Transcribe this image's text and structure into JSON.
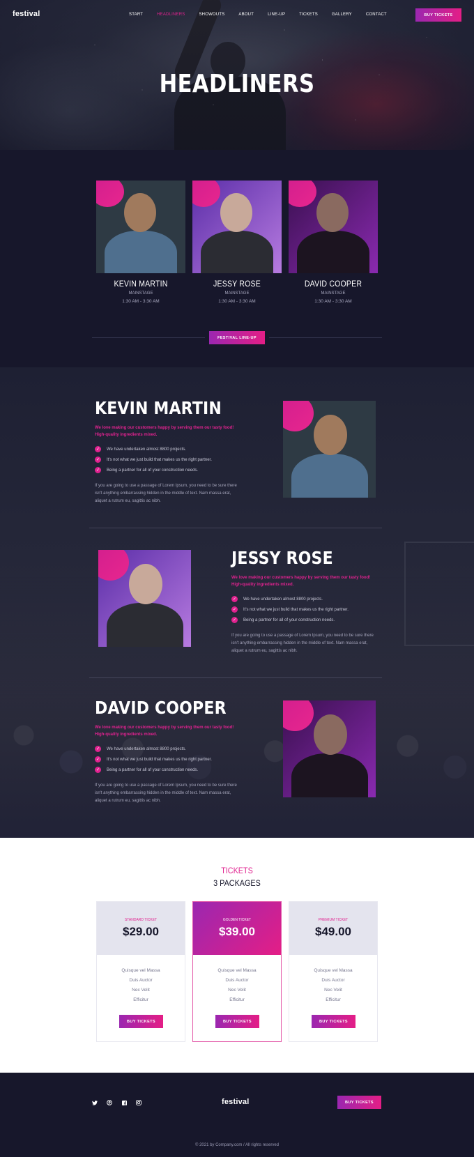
{
  "nav": {
    "logo": "festival",
    "items": [
      {
        "label": "START",
        "active": false
      },
      {
        "label": "HEADLINERS",
        "active": true
      },
      {
        "label": "SHOWOUTS",
        "active": false
      },
      {
        "label": "ABOUT",
        "active": false
      },
      {
        "label": "LINE-UP",
        "active": false
      },
      {
        "label": "TICKETS",
        "active": false
      },
      {
        "label": "GALLERY",
        "active": false
      },
      {
        "label": "CONTACT",
        "active": false
      }
    ],
    "cta": "BUY TICKETS"
  },
  "hero": {
    "title": "HEADLINERS"
  },
  "lineup": {
    "cards": [
      {
        "name": "KEVIN MARTIN",
        "stage": "MAINSTAGE",
        "time": "1:30 AM - 3:30 AM"
      },
      {
        "name": "JESSY ROSE",
        "stage": "MAINSTAGE",
        "time": "1:30 AM - 3:30 AM"
      },
      {
        "name": "DAVID COOPER",
        "stage": "MAINSTAGE",
        "time": "1:30 AM - 3:30 AM"
      }
    ],
    "button": "FESTIVAL LINE-UP"
  },
  "artists": [
    {
      "name": "KEVIN MARTIN",
      "intro": "We love making our customers happy by serving them our tasty food! High-quality ingredients mixed.",
      "checks": [
        "We have undertaken almost 8800 projects.",
        "It's not what we just build that makes us the right partner.",
        "Being a partner for all of your construction needs."
      ],
      "body": "If you are going to use a passage of Lorem Ipsum, you need to be sure there isn't anything embarrassing hidden in the middle of text. Nam massa erat, aliquet a rutrum eu, sagittis ac nibh."
    },
    {
      "name": "JESSY ROSE",
      "intro": "We love making our customers happy by serving them our tasty food! High-quality ingredients mixed.",
      "checks": [
        "We have undertaken almost 8800 projects.",
        "It's not what we just build that makes us the right partner.",
        "Being a partner for all of your construction needs."
      ],
      "body": "If you are going to use a passage of Lorem Ipsum, you need to be sure there isn't anything embarrassing hidden in the middle of text. Nam massa erat, aliquet a rutrum eu, sagittis ac nibh."
    },
    {
      "name": "DAVID COOPER",
      "intro": "We love making our customers happy by serving them our tasty food! High-quality ingredients mixed.",
      "checks": [
        "We have undertaken almost 8800 projects.",
        "It's not what we just build that makes us the right partner.",
        "Being a partner for all of your construction needs."
      ],
      "body": "If you are going to use a passage of Lorem Ipsum, you need to be sure there isn't anything embarrassing hidden in the middle of text. Nam massa erat, aliquet a rutrum eu, sagittis ac nibh."
    }
  ],
  "tickets": {
    "kicker": "TICKETS",
    "heading": "3 PACKAGES",
    "packages": [
      {
        "label": "STANDARD TICKET",
        "price": "$29.00",
        "features": [
          "Quisque vel Massa",
          "Duis Auctor",
          "Nec Velit",
          "Efficitur"
        ],
        "button": "BUY TICKETS",
        "featured": false
      },
      {
        "label": "GOLDEN TICKET",
        "price": "$39.00",
        "features": [
          "Quisque vel Massa",
          "Duis Auctor",
          "Nec Velit",
          "Efficitur"
        ],
        "button": "BUY TICKETS",
        "featured": true
      },
      {
        "label": "PREMIUM TICKET",
        "price": "$49.00",
        "features": [
          "Quisque vel Massa",
          "Duis Auctor",
          "Nec Velit",
          "Efficitur"
        ],
        "button": "BUY TICKETS",
        "featured": false
      }
    ]
  },
  "footer": {
    "logo": "festival",
    "socials": [
      "twitter-icon",
      "pinterest-icon",
      "facebook-icon",
      "instagram-icon"
    ],
    "cta": "BUY TICKETS",
    "copyright": "©  2021 by Company.com  /  All rights reserved"
  },
  "colors": {
    "accent": "#e0228f",
    "gradient_start": "#9b27b0",
    "gradient_end": "#e41e86",
    "dark_bg": "#17172b"
  }
}
